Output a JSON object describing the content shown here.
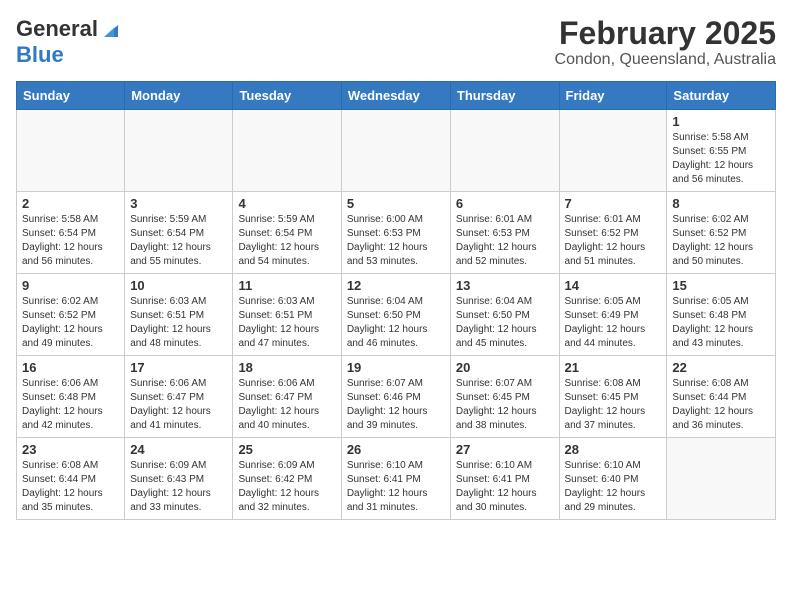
{
  "logo": {
    "general": "General",
    "blue": "Blue"
  },
  "title": "February 2025",
  "subtitle": "Condon, Queensland, Australia",
  "weekdays": [
    "Sunday",
    "Monday",
    "Tuesday",
    "Wednesday",
    "Thursday",
    "Friday",
    "Saturday"
  ],
  "weeks": [
    [
      {
        "day": "",
        "info": ""
      },
      {
        "day": "",
        "info": ""
      },
      {
        "day": "",
        "info": ""
      },
      {
        "day": "",
        "info": ""
      },
      {
        "day": "",
        "info": ""
      },
      {
        "day": "",
        "info": ""
      },
      {
        "day": "1",
        "info": "Sunrise: 5:58 AM\nSunset: 6:55 PM\nDaylight: 12 hours\nand 56 minutes."
      }
    ],
    [
      {
        "day": "2",
        "info": "Sunrise: 5:58 AM\nSunset: 6:54 PM\nDaylight: 12 hours\nand 56 minutes."
      },
      {
        "day": "3",
        "info": "Sunrise: 5:59 AM\nSunset: 6:54 PM\nDaylight: 12 hours\nand 55 minutes."
      },
      {
        "day": "4",
        "info": "Sunrise: 5:59 AM\nSunset: 6:54 PM\nDaylight: 12 hours\nand 54 minutes."
      },
      {
        "day": "5",
        "info": "Sunrise: 6:00 AM\nSunset: 6:53 PM\nDaylight: 12 hours\nand 53 minutes."
      },
      {
        "day": "6",
        "info": "Sunrise: 6:01 AM\nSunset: 6:53 PM\nDaylight: 12 hours\nand 52 minutes."
      },
      {
        "day": "7",
        "info": "Sunrise: 6:01 AM\nSunset: 6:52 PM\nDaylight: 12 hours\nand 51 minutes."
      },
      {
        "day": "8",
        "info": "Sunrise: 6:02 AM\nSunset: 6:52 PM\nDaylight: 12 hours\nand 50 minutes."
      }
    ],
    [
      {
        "day": "9",
        "info": "Sunrise: 6:02 AM\nSunset: 6:52 PM\nDaylight: 12 hours\nand 49 minutes."
      },
      {
        "day": "10",
        "info": "Sunrise: 6:03 AM\nSunset: 6:51 PM\nDaylight: 12 hours\nand 48 minutes."
      },
      {
        "day": "11",
        "info": "Sunrise: 6:03 AM\nSunset: 6:51 PM\nDaylight: 12 hours\nand 47 minutes."
      },
      {
        "day": "12",
        "info": "Sunrise: 6:04 AM\nSunset: 6:50 PM\nDaylight: 12 hours\nand 46 minutes."
      },
      {
        "day": "13",
        "info": "Sunrise: 6:04 AM\nSunset: 6:50 PM\nDaylight: 12 hours\nand 45 minutes."
      },
      {
        "day": "14",
        "info": "Sunrise: 6:05 AM\nSunset: 6:49 PM\nDaylight: 12 hours\nand 44 minutes."
      },
      {
        "day": "15",
        "info": "Sunrise: 6:05 AM\nSunset: 6:48 PM\nDaylight: 12 hours\nand 43 minutes."
      }
    ],
    [
      {
        "day": "16",
        "info": "Sunrise: 6:06 AM\nSunset: 6:48 PM\nDaylight: 12 hours\nand 42 minutes."
      },
      {
        "day": "17",
        "info": "Sunrise: 6:06 AM\nSunset: 6:47 PM\nDaylight: 12 hours\nand 41 minutes."
      },
      {
        "day": "18",
        "info": "Sunrise: 6:06 AM\nSunset: 6:47 PM\nDaylight: 12 hours\nand 40 minutes."
      },
      {
        "day": "19",
        "info": "Sunrise: 6:07 AM\nSunset: 6:46 PM\nDaylight: 12 hours\nand 39 minutes."
      },
      {
        "day": "20",
        "info": "Sunrise: 6:07 AM\nSunset: 6:45 PM\nDaylight: 12 hours\nand 38 minutes."
      },
      {
        "day": "21",
        "info": "Sunrise: 6:08 AM\nSunset: 6:45 PM\nDaylight: 12 hours\nand 37 minutes."
      },
      {
        "day": "22",
        "info": "Sunrise: 6:08 AM\nSunset: 6:44 PM\nDaylight: 12 hours\nand 36 minutes."
      }
    ],
    [
      {
        "day": "23",
        "info": "Sunrise: 6:08 AM\nSunset: 6:44 PM\nDaylight: 12 hours\nand 35 minutes."
      },
      {
        "day": "24",
        "info": "Sunrise: 6:09 AM\nSunset: 6:43 PM\nDaylight: 12 hours\nand 33 minutes."
      },
      {
        "day": "25",
        "info": "Sunrise: 6:09 AM\nSunset: 6:42 PM\nDaylight: 12 hours\nand 32 minutes."
      },
      {
        "day": "26",
        "info": "Sunrise: 6:10 AM\nSunset: 6:41 PM\nDaylight: 12 hours\nand 31 minutes."
      },
      {
        "day": "27",
        "info": "Sunrise: 6:10 AM\nSunset: 6:41 PM\nDaylight: 12 hours\nand 30 minutes."
      },
      {
        "day": "28",
        "info": "Sunrise: 6:10 AM\nSunset: 6:40 PM\nDaylight: 12 hours\nand 29 minutes."
      },
      {
        "day": "",
        "info": ""
      }
    ]
  ]
}
